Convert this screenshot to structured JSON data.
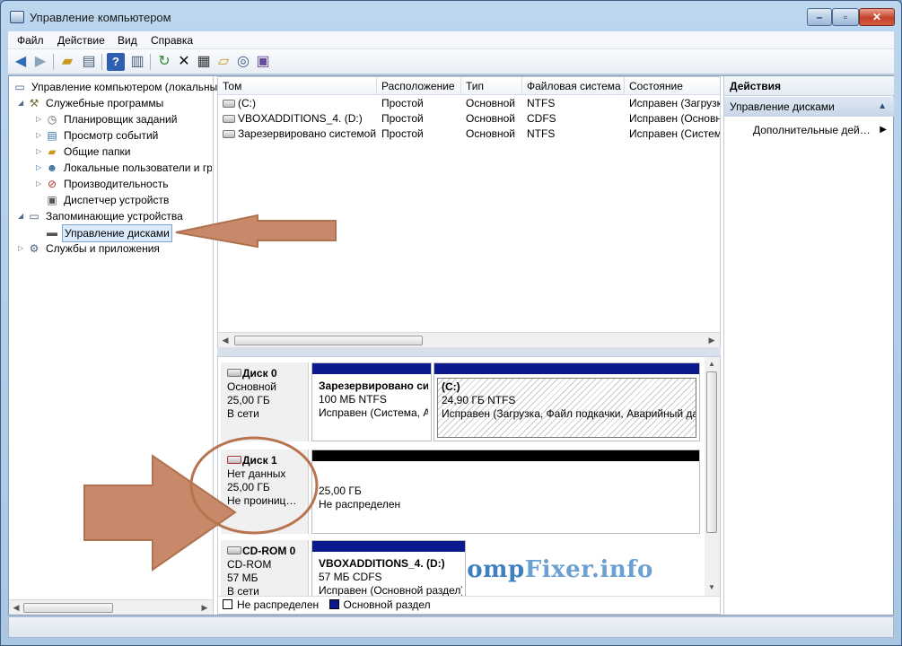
{
  "window": {
    "title": "Управление компьютером",
    "buttons": {
      "minimize": "–",
      "maximize": "▫",
      "close": "✕"
    }
  },
  "menu": [
    "Файл",
    "Действие",
    "Вид",
    "Справка"
  ],
  "toolbar": {
    "icons": [
      "back-arrow-icon",
      "forward-arrow-icon",
      "up-folder-icon",
      "show-hide-tree-icon",
      "help-icon",
      "show-hide-action-pane-icon",
      "refresh-icon",
      "delete-icon",
      "properties-icon",
      "open-icon",
      "search-icon",
      "help-book-icon"
    ]
  },
  "tree": {
    "root": "Управление компьютером (локальным)",
    "utilities": "Служебные программы",
    "task_scheduler": "Планировщик заданий",
    "event_viewer": "Просмотр событий",
    "shared_folders": "Общие папки",
    "local_users": "Локальные пользователи и группы",
    "performance": "Производительность",
    "device_manager": "Диспетчер устройств",
    "storage": "Запоминающие устройства",
    "disk_management": "Управление дисками",
    "services": "Службы и приложения"
  },
  "volumes": {
    "columns": [
      "Том",
      "Расположение",
      "Тип",
      "Файловая система",
      "Состояние"
    ],
    "rows": [
      [
        "(C:)",
        "Простой",
        "Основной",
        "NTFS",
        "Исправен (Загрузка, Файл подкачки, Аварийный дамп, Основной раздел)"
      ],
      [
        "VBOXADDITIONS_4. (D:)",
        "Простой",
        "Основной",
        "CDFS",
        "Исправен (Основной раздел)"
      ],
      [
        "Зарезервировано системой",
        "Простой",
        "Основной",
        "NTFS",
        "Исправен (Система, Активен, Основной раздел)"
      ]
    ]
  },
  "disks": {
    "disk0": {
      "name": "Диск 0",
      "type": "Основной",
      "size": "25,00 ГБ",
      "status": "В сети",
      "p1": {
        "name": "Зарезервировано системой",
        "size": "100 МБ NTFS",
        "status": "Исправен (Система, Активен)"
      },
      "p2": {
        "name": "(C:)",
        "size": "24,90 ГБ NTFS",
        "status": "Исправен (Загрузка, Файл подкачки, Аварийный дамп)"
      }
    },
    "disk1": {
      "name": "Диск 1",
      "type": "Нет данных",
      "size": "25,00 ГБ",
      "status": "Не проинициализирован",
      "p1": {
        "size": "25,00 ГБ",
        "status": "Не распределен"
      }
    },
    "cdrom0": {
      "name": "CD-ROM 0",
      "type": "CD-ROM",
      "size": "57 МБ",
      "status": "В сети",
      "p1": {
        "name": "VBOXADDITIONS_4. (D:)",
        "size": "57 МБ CDFS",
        "status": "Исправен (Основной раздел)"
      }
    }
  },
  "legend": {
    "unallocated": "Не распределен",
    "primary": "Основной раздел"
  },
  "actions": {
    "header": "Действия",
    "section": "Управление дисками",
    "more": "Дополнительные действия"
  },
  "watermark": {
    "part1": "Comp",
    "part2": "Fixer.info"
  },
  "colors": {
    "primary_partition": "#0a1a8c",
    "unallocated": "#000000",
    "annotation_arrow": "#c8896a",
    "annotation_stroke": "#b0714f"
  }
}
